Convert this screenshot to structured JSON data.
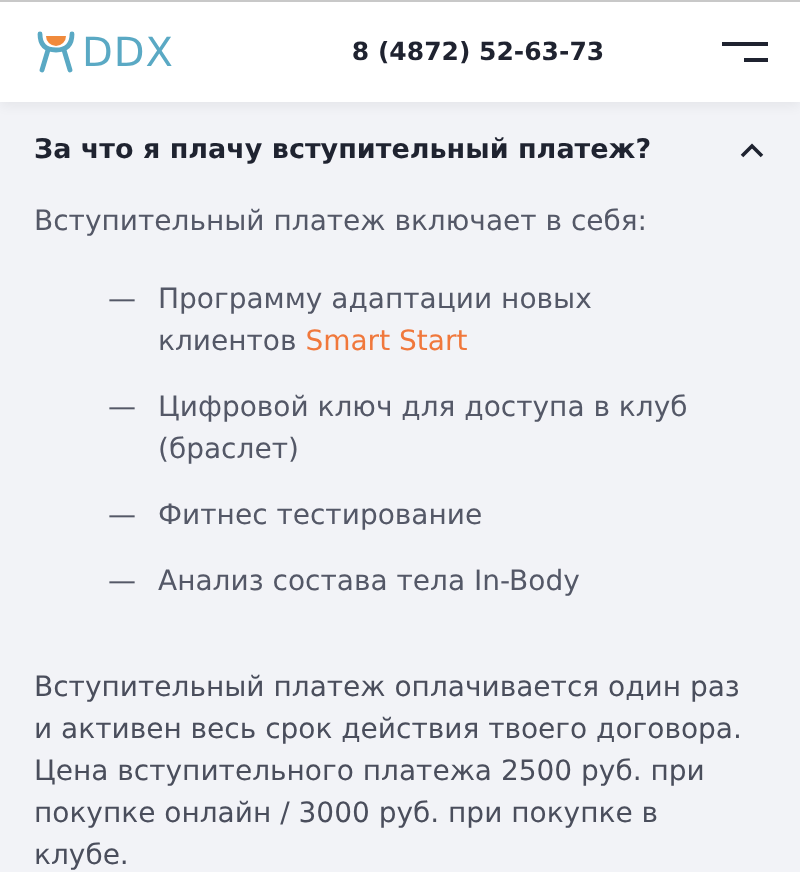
{
  "header": {
    "logo": "DDX",
    "phone": "8 (4872) 52-63-73"
  },
  "faq": {
    "question": "За что я плачу вступительный платеж?",
    "expanded": true,
    "intro": "Вступительный платеж включает в себя:",
    "items": [
      {
        "marker": "—",
        "text": "Программу адаптации новых клиентов",
        "link": "Smart Start"
      },
      {
        "marker": "—",
        "text": "Цифровой ключ для доступа в клуб (браслет)"
      },
      {
        "marker": "—",
        "text": "Фитнес тестирование"
      },
      {
        "marker": "—",
        "text": "Анализ состава тела In-Body"
      }
    ],
    "note": "Вступительный платеж оплачивается один раз и активен весь срок действия твоего договора. Цена вступительного платежа 2500 руб. при покупке онлайн / 3000 руб. при покупке в клубе."
  }
}
